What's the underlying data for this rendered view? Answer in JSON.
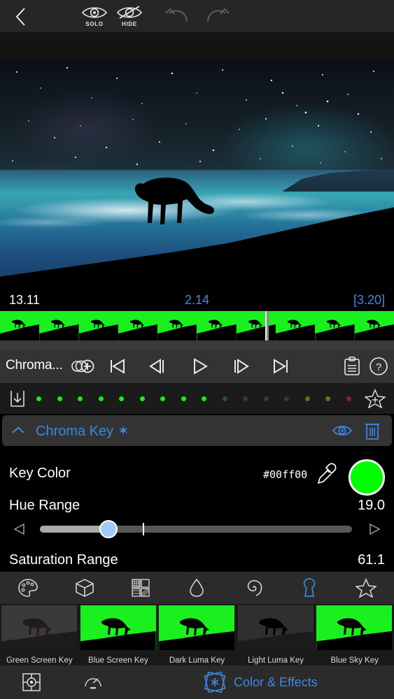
{
  "topbar": {
    "back_icon": "chevron-left-icon",
    "solo_label": "SOLO",
    "hide_label": "HIDE",
    "solo_icon": "eye-icon",
    "hide_icon": "eye-slash-icon",
    "undo_icon": "undo-arrow-icon",
    "redo_icon": "redo-arrow-icon"
  },
  "timecode": {
    "left": "13.11",
    "center": "2.14",
    "right": "[3.20]"
  },
  "transport": {
    "clip_label": "Chroma...",
    "add_keyframe_icon": "add-keyframe-icon",
    "skip_start_icon": "skip-to-start-icon",
    "step_back_icon": "step-backward-icon",
    "play_icon": "play-icon",
    "step_forward_icon": "step-forward-icon",
    "skip_end_icon": "skip-to-end-icon",
    "clipboard_icon": "clipboard-icon",
    "help_icon": "help-icon"
  },
  "keyframe_row": {
    "download_icon": "download-icon",
    "favorite_icon": "star-plus-icon",
    "dot_colors": [
      "#1fe81f",
      "#1fe81f",
      "#1fe81f",
      "#1fe81f",
      "#1fe81f",
      "#1fe81f",
      "#1fe81f",
      "#1fe81f",
      "#1fe81f",
      "#1d5a1d",
      "#1c4d1c",
      "#1f4a1c",
      "#22441e",
      "#7a651c",
      "#7a6a1c",
      "#8a2020"
    ]
  },
  "effect_header": {
    "collapse_icon": "chevron-up-icon",
    "title": "Chroma Key ✶",
    "visibility_icon": "eye-icon",
    "delete_icon": "trash-icon",
    "accent_color": "#3d88e0"
  },
  "parameters": {
    "key_color": {
      "label": "Key Color",
      "hex": "#00ff00",
      "eyedropper_icon": "eyedropper-icon",
      "swatch_name": "color-swatch"
    },
    "hue_range": {
      "label": "Hue Range",
      "value": "19.0",
      "percent": 22,
      "tick_percent": 33,
      "left_arrow_icon": "triangle-left-icon",
      "right_arrow_icon": "triangle-right-icon"
    },
    "saturation_range": {
      "label": "Saturation Range",
      "value": "61.1"
    }
  },
  "category_tabs": [
    {
      "name": "palette-icon",
      "active": false
    },
    {
      "name": "cube-icon",
      "active": false
    },
    {
      "name": "patterns-icon",
      "active": false
    },
    {
      "name": "droplet-icon",
      "active": false
    },
    {
      "name": "spiral-icon",
      "active": false
    },
    {
      "name": "keyhole-icon",
      "active": true
    },
    {
      "name": "star-icon",
      "active": false
    }
  ],
  "presets": [
    {
      "label": "Green Screen Key",
      "style": "gs"
    },
    {
      "label": "Blue Screen Key",
      "style": "green"
    },
    {
      "label": "Dark Luma Key",
      "style": "green"
    },
    {
      "label": "Light Luma Key",
      "style": "dark"
    },
    {
      "label": "Blue Sky Key",
      "style": "green"
    }
  ],
  "bottombar": {
    "target_icon": "target-icon",
    "speed_icon": "speedometer-icon",
    "section_icon": "color-effects-icon",
    "section_label": "Color & Effects"
  }
}
